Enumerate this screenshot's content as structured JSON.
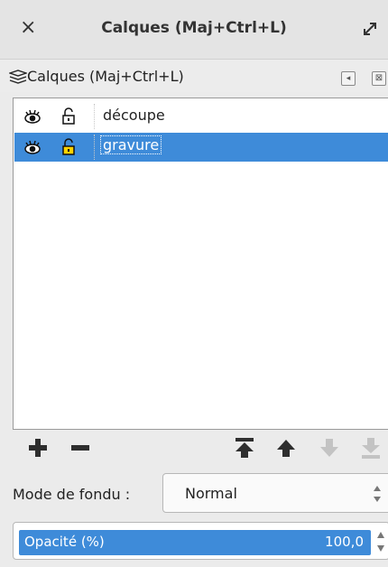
{
  "window": {
    "title": "Calques (Maj+Ctrl+L)",
    "close_glyph": "×",
    "expand_icon": "expand-icon"
  },
  "panel": {
    "title": "Calques (Maj+Ctrl+L)",
    "icon": "layers-icon",
    "btn_left_glyph": "◂",
    "btn_close_glyph": "⊠"
  },
  "layers": [
    {
      "name": "découpe",
      "visible": true,
      "locked": false,
      "selected": false
    },
    {
      "name": "gravure",
      "visible": true,
      "locked": false,
      "selected": true
    }
  ],
  "toolbar": {
    "buttons": [
      "add-layer",
      "remove-layer",
      "raise-to-top",
      "raise",
      "lower",
      "lower-to-bottom"
    ]
  },
  "blend": {
    "label": "Mode de fondu :",
    "value": "Normal"
  },
  "opacity": {
    "label": "Opacité (%)",
    "value": "100,0",
    "fraction": 1.0
  },
  "colors": {
    "selection": "#3e8bd9",
    "disabled_icon": "#c3c3c3",
    "icon": "#2e2e2e"
  }
}
